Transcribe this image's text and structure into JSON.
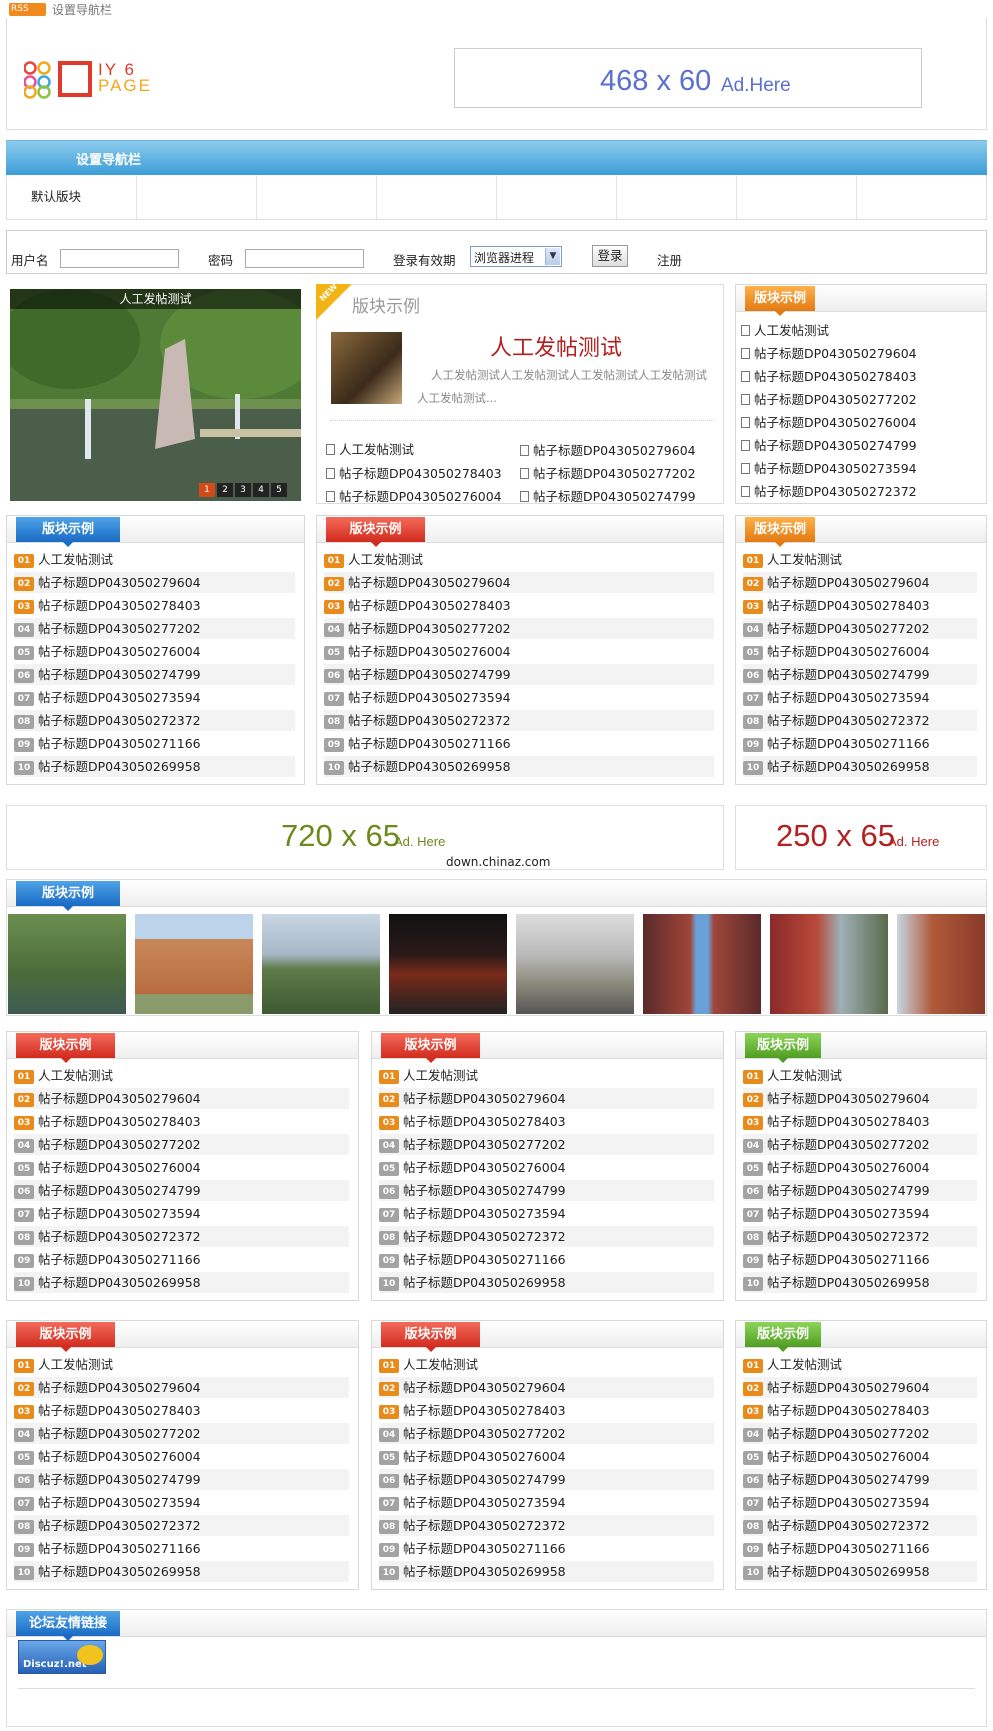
{
  "topbar": {
    "rss": "RSS",
    "nav_link": "设置导航栏"
  },
  "header": {
    "logo_top": "IY 6",
    "logo_bottom": "PAGE",
    "ad_top_size": "468 x 60",
    "ad_top_text": "Ad.Here"
  },
  "nav": {
    "label": "设置导航栏",
    "sub_item": "默认版块"
  },
  "login": {
    "username_label": "用户名",
    "password_label": "密码",
    "expire_label": "登录有效期",
    "expire_value": "浏览器进程",
    "submit": "登录",
    "register": "注册"
  },
  "slide": {
    "title": "人工发帖测试",
    "pages": [
      "1",
      "2",
      "3",
      "4",
      "5"
    ]
  },
  "featured": {
    "badge": "NEW",
    "heading": "版块示例",
    "title": "人工发帖测试",
    "desc": "人工发帖测试人工发帖测试人工发帖测试人工发帖测试人工发帖测试...",
    "items": [
      "人工发帖测试",
      "帖子标题DP043050279604",
      "帖子标题DP043050278403",
      "帖子标题DP043050277202",
      "帖子标题DP043050276004",
      "帖子标题DP043050274799"
    ]
  },
  "sidebar_top": {
    "tab": "版块示例",
    "items": [
      "人工发帖测试",
      "帖子标题DP043050279604",
      "帖子标题DP043050278403",
      "帖子标题DP043050277202",
      "帖子标题DP043050276004",
      "帖子标题DP043050274799",
      "帖子标题DP043050273594",
      "帖子标题DP043050272372"
    ]
  },
  "block_tab": "版块示例",
  "list_numbers": [
    "01",
    "02",
    "03",
    "04",
    "05",
    "06",
    "07",
    "08",
    "09",
    "10"
  ],
  "list_items": [
    "人工发帖测试",
    "帖子标题DP043050279604",
    "帖子标题DP043050278403",
    "帖子标题DP043050277202",
    "帖子标题DP043050276004",
    "帖子标题DP043050274799",
    "帖子标题DP043050273594",
    "帖子标题DP043050272372",
    "帖子标题DP043050271166",
    "帖子标题DP043050269958"
  ],
  "ads_mid": {
    "ad720_size": "720 x 65",
    "ad720_text": "Ad. Here",
    "ad250_size": "250 x 65",
    "ad250_text": "Ad. Here",
    "watermark": "down.chinaz.com"
  },
  "gallery_tab": "版块示例",
  "friend_links": {
    "tab": "论坛友情链接",
    "logo": "Discuz!.net"
  },
  "colors": {
    "nav_blue": "#3c9ed8",
    "tab_orange": "#e27a12",
    "tab_red": "#d12c1e",
    "tab_green": "#4f9e22",
    "tab_blue": "#1a6bc4",
    "title_red": "#b41f1f",
    "ad_blue": "#5a6fd0",
    "ad_olive": "#6b8a1a",
    "ad_red": "#b41f1f"
  }
}
